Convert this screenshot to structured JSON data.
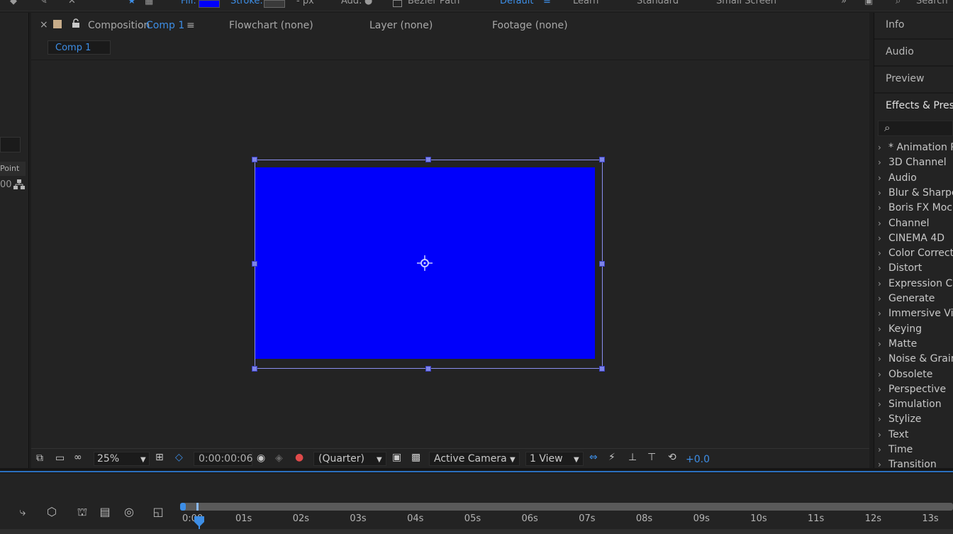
{
  "toolbar": {
    "fill_label": "Fill:",
    "stroke_label": "Stroke:",
    "stroke_unit": "- px",
    "add_label": "Add:",
    "bezier_label": "Bezier Path",
    "workspaces": [
      "Default",
      "Learn",
      "Standard",
      "Small Screen"
    ],
    "search_label": "Search"
  },
  "left_panel": {
    "point_label": "Point",
    "value_fragment": "00"
  },
  "composition_tabs": {
    "close_glyph": "×",
    "comp_label": "Composition",
    "comp_name": "Comp 1",
    "menu_glyph": "≡",
    "flowchart": "Flowchart  (none)",
    "layer": "Layer  (none)",
    "footage": "Footage  (none)"
  },
  "subtab": {
    "label": "Comp 1"
  },
  "viewer": {
    "zoom": "25%",
    "timecode": "0:00:00:06",
    "resolution": "(Quarter)",
    "camera": "Active Camera",
    "views": "1 View",
    "exposure": "+0.0",
    "fill_color": "#0000fb"
  },
  "right_panel": {
    "panels": [
      "Info",
      "Audio",
      "Preview",
      "Effects & Presets"
    ],
    "effects": [
      "* Animation Presets",
      "3D Channel",
      "Audio",
      "Blur & Sharpen",
      "Boris FX Mocha",
      "Channel",
      "CINEMA 4D",
      "Color Correction",
      "Distort",
      "Expression Controls",
      "Generate",
      "Immersive Video",
      "Keying",
      "Matte",
      "Noise & Grain",
      "Obsolete",
      "Perspective",
      "Simulation",
      "Stylize",
      "Text",
      "Time",
      "Transition"
    ]
  },
  "timeline": {
    "start": "0:00",
    "ticks": [
      "01s",
      "02s",
      "03s",
      "04s",
      "05s",
      "06s",
      "07s",
      "08s",
      "09s",
      "10s",
      "11s",
      "12s",
      "13s"
    ]
  },
  "colors": {
    "accent": "#3d8ee6",
    "panel_bg": "#232323",
    "selection": "#8b8ff0"
  }
}
